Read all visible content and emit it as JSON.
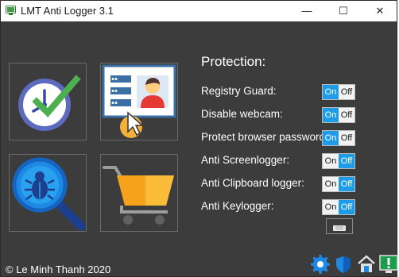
{
  "window": {
    "title": "LMT Anti Logger 3.1",
    "controls": {
      "minimize": "—",
      "maximize": "☐",
      "close": "✕"
    }
  },
  "tiles": [
    {
      "name": "status-tile",
      "icon": "clock-check-icon"
    },
    {
      "name": "user-info-tile",
      "icon": "user-panel-icon"
    },
    {
      "name": "scan-tile",
      "icon": "bug-magnifier-icon"
    },
    {
      "name": "shop-tile",
      "icon": "shopping-cart-icon"
    }
  ],
  "protection": {
    "title": "Protection:",
    "items": [
      {
        "label": "Registry Guard:",
        "on": "On",
        "off": "Off",
        "state": "on"
      },
      {
        "label": "Disable webcam:",
        "on": "On",
        "off": "Off",
        "state": "on"
      },
      {
        "label": "Protect browser password:",
        "on": "On",
        "off": "Off",
        "state": "on"
      },
      {
        "label": "Anti Screenlogger:",
        "on": "On",
        "off": "Off",
        "state": "off"
      },
      {
        "label": "Anti Clipboard logger:",
        "on": "On",
        "off": "Off",
        "state": "off"
      },
      {
        "label": "Anti Keylogger:",
        "on": "On",
        "off": "Off",
        "state": "off"
      }
    ]
  },
  "footer": {
    "copyright": "© Le Minh Thanh 2020"
  },
  "bottom_icons": [
    "settings-icon",
    "shield-icon",
    "home-icon",
    "status-icon"
  ],
  "colors": {
    "accent": "#1e9be9",
    "background": "#3c3c3c",
    "cart": "#f7a21b",
    "check": "#4caf50"
  }
}
